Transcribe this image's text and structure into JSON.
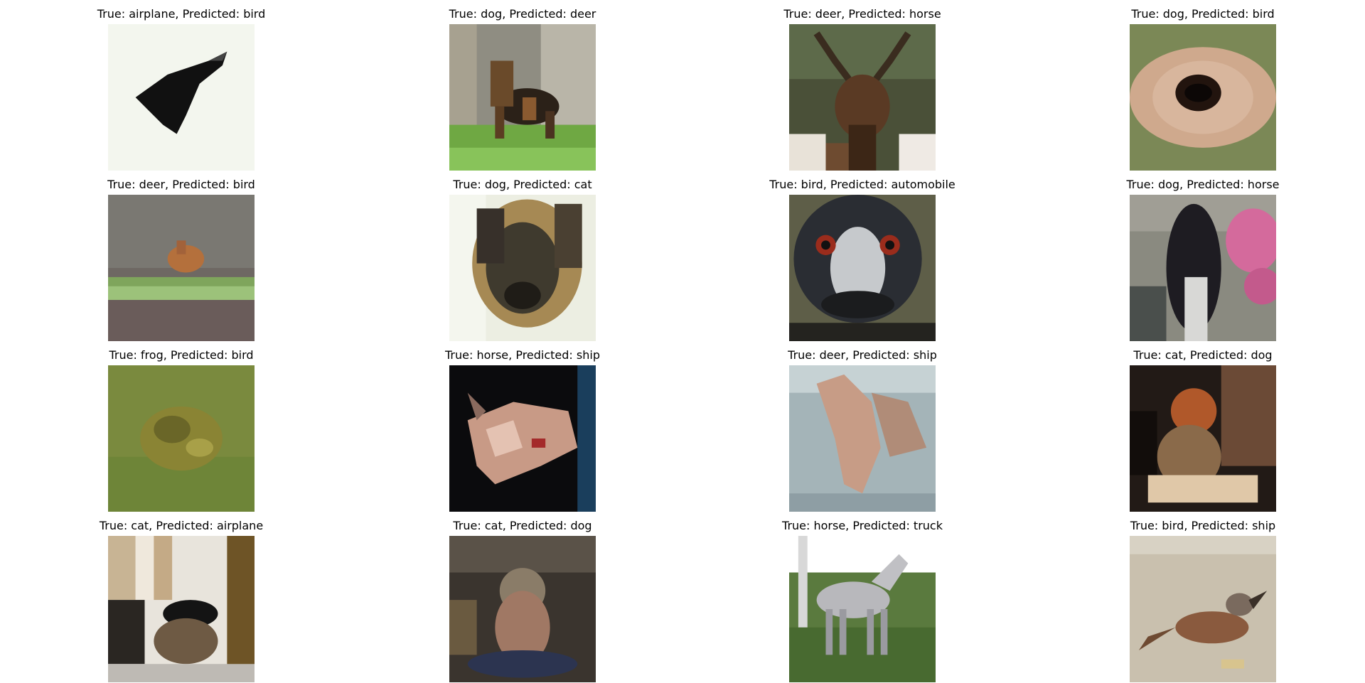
{
  "panels": [
    {
      "title": "True: airplane, Predicted: bird",
      "true_label": "airplane",
      "predicted_label": "bird"
    },
    {
      "title": "True: dog, Predicted: deer",
      "true_label": "dog",
      "predicted_label": "deer"
    },
    {
      "title": "True: deer, Predicted: horse",
      "true_label": "deer",
      "predicted_label": "horse"
    },
    {
      "title": "True: dog, Predicted: bird",
      "true_label": "dog",
      "predicted_label": "bird"
    },
    {
      "title": "True: deer, Predicted: bird",
      "true_label": "deer",
      "predicted_label": "bird"
    },
    {
      "title": "True: dog, Predicted: cat",
      "true_label": "dog",
      "predicted_label": "cat"
    },
    {
      "title": "True: bird, Predicted: automobile",
      "true_label": "bird",
      "predicted_label": "automobile"
    },
    {
      "title": "True: dog, Predicted: horse",
      "true_label": "dog",
      "predicted_label": "horse"
    },
    {
      "title": "True: frog, Predicted: bird",
      "true_label": "frog",
      "predicted_label": "bird"
    },
    {
      "title": "True: horse, Predicted: ship",
      "true_label": "horse",
      "predicted_label": "ship"
    },
    {
      "title": "True: deer, Predicted: ship",
      "true_label": "deer",
      "predicted_label": "ship"
    },
    {
      "title": "True: cat, Predicted: dog",
      "true_label": "cat",
      "predicted_label": "dog"
    },
    {
      "title": "True: cat, Predicted: airplane",
      "true_label": "cat",
      "predicted_label": "airplane"
    },
    {
      "title": "True: cat, Predicted: dog",
      "true_label": "cat",
      "predicted_label": "dog"
    },
    {
      "title": "True: horse, Predicted: truck",
      "true_label": "horse",
      "predicted_label": "truck"
    },
    {
      "title": "True: bird, Predicted: ship",
      "true_label": "bird",
      "predicted_label": "ship"
    }
  ]
}
